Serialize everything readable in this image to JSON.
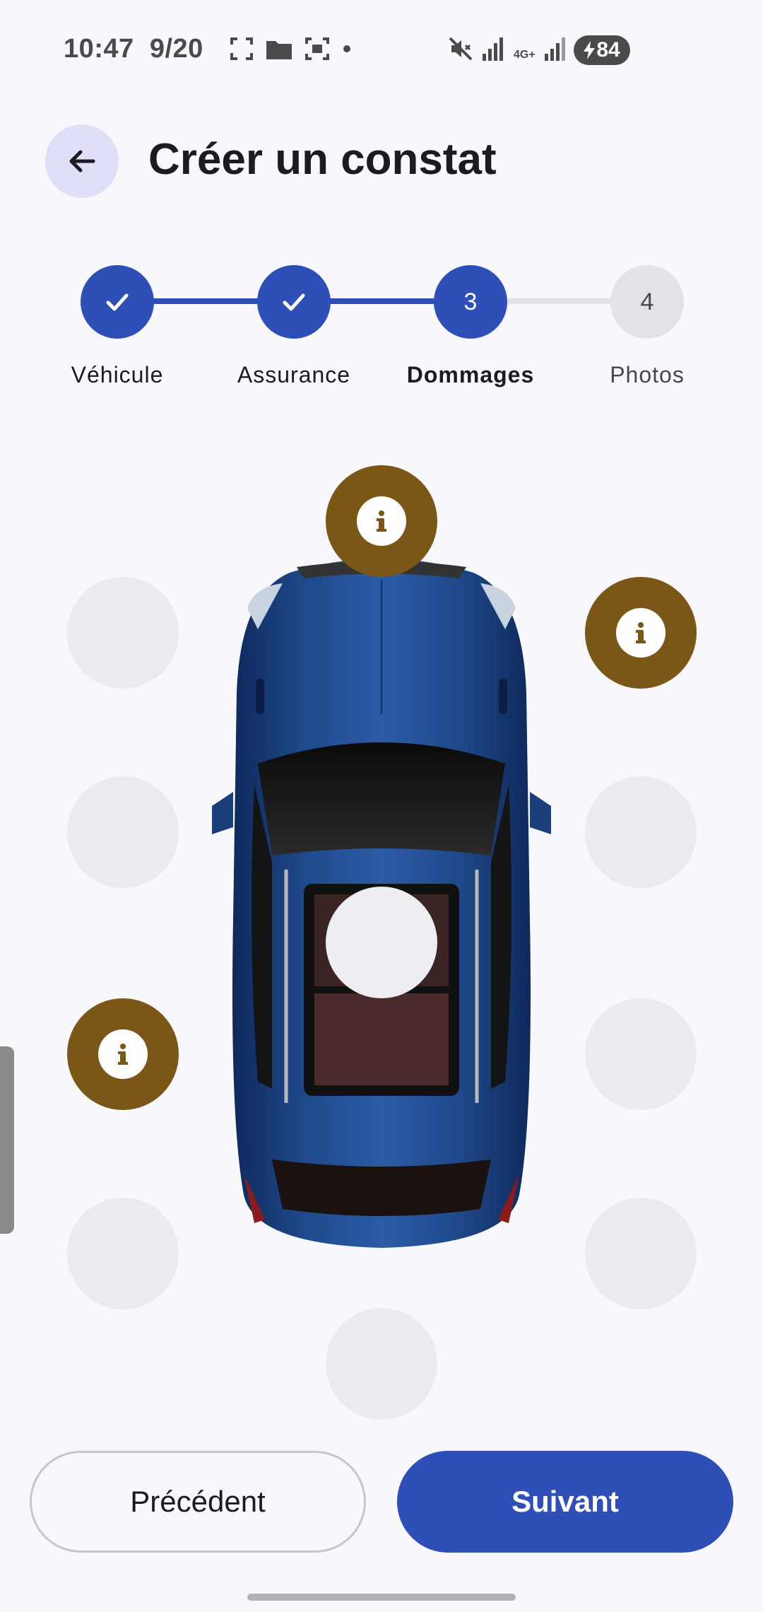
{
  "status_bar": {
    "time": "10:47",
    "date": "9/20",
    "network": "4G+",
    "battery": "84"
  },
  "header": {
    "title": "Créer un constat",
    "back_icon": "arrow-left-icon"
  },
  "stepper": {
    "steps": [
      {
        "number": "1",
        "label": "Véhicule",
        "state": "done"
      },
      {
        "number": "2",
        "label": "Assurance",
        "state": "done"
      },
      {
        "number": "3",
        "label": "Dommages",
        "state": "current"
      },
      {
        "number": "4",
        "label": "Photos",
        "state": "upcoming"
      }
    ]
  },
  "damage_zones": {
    "marked_color": "#7a5617",
    "empty_color": "#ebeaf0",
    "zones": [
      {
        "id": "front",
        "marked": true
      },
      {
        "id": "front-left",
        "marked": false
      },
      {
        "id": "front-right",
        "marked": true
      },
      {
        "id": "left-mid-front",
        "marked": false
      },
      {
        "id": "right-mid-front",
        "marked": false
      },
      {
        "id": "roof-center",
        "marked": false
      },
      {
        "id": "left-mid-rear",
        "marked": true
      },
      {
        "id": "right-mid-rear",
        "marked": false
      },
      {
        "id": "rear-left",
        "marked": false
      },
      {
        "id": "rear-right",
        "marked": false
      },
      {
        "id": "rear",
        "marked": false
      }
    ]
  },
  "footer": {
    "prev_label": "Précédent",
    "next_label": "Suivant"
  },
  "colors": {
    "primary": "#2f4fb8",
    "step_inactive": "#e3e2e9",
    "background": "#f8f7fc",
    "car_body": "#1f4a8c"
  }
}
